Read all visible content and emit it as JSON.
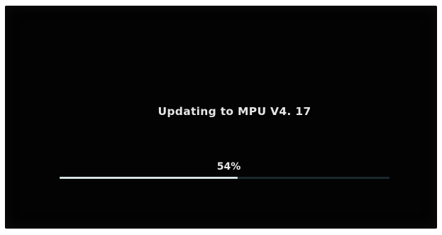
{
  "update": {
    "title": "Updating to MPU V4. 17",
    "percent_label": "54%",
    "progress": 0.54
  },
  "colors": {
    "screen_background": "#030303",
    "text": "#e6e6e6",
    "progress_fill": "#dfe9ec",
    "progress_track": "#1a2a2f"
  }
}
